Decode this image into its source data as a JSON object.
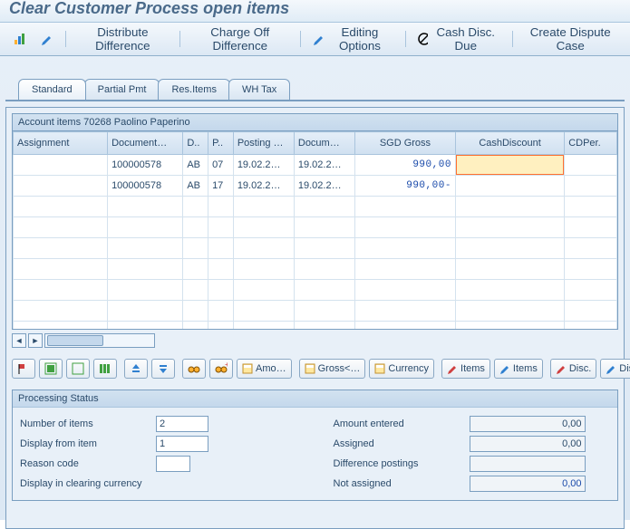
{
  "title": "Clear Customer Process open items",
  "toolbar": {
    "distribute": "Distribute Difference",
    "charge_off": "Charge Off Difference",
    "editing": "Editing Options",
    "cash_disc": "Cash Disc. Due",
    "dispute": "Create Dispute Case"
  },
  "tabs": [
    "Standard",
    "Partial Pmt",
    "Res.Items",
    "WH Tax"
  ],
  "active_tab": 0,
  "panel_title": "Account items 70268 Paolino Paperino",
  "columns": [
    {
      "key": "assignment",
      "label": "Assignment",
      "w": 90
    },
    {
      "key": "document",
      "label": "Document…",
      "w": 72
    },
    {
      "key": "d",
      "label": "D..",
      "w": 24
    },
    {
      "key": "p",
      "label": "P..",
      "w": 24
    },
    {
      "key": "posting",
      "label": "Posting …",
      "w": 58
    },
    {
      "key": "docum",
      "label": "Docum…",
      "w": 58
    },
    {
      "key": "sgd",
      "label": "SGD Gross",
      "w": 96
    },
    {
      "key": "cashdisc",
      "label": "CashDiscount",
      "w": 104
    },
    {
      "key": "cdper",
      "label": "CDPer.",
      "w": 50
    }
  ],
  "rows": [
    {
      "assignment": "",
      "document": "100000578",
      "d": "AB",
      "p": "07",
      "posting": "19.02.2…",
      "docum": "19.02.2…",
      "sgd": "990,00",
      "cashdisc": "",
      "cdper": "",
      "sel": "cashdisc"
    },
    {
      "assignment": "",
      "document": "100000578",
      "d": "AB",
      "p": "17",
      "posting": "19.02.2…",
      "docum": "19.02.2…",
      "sgd": "990,00-",
      "cashdisc": "",
      "cdper": ""
    }
  ],
  "buttons": {
    "amo": "Amo…",
    "gross": "Gross<…",
    "currency": "Currency",
    "items1": "Items",
    "items2": "Items",
    "disc1": "Disc.",
    "disc2": "Disc."
  },
  "status": {
    "title": "Processing Status",
    "left": {
      "num_items": {
        "label": "Number of items",
        "value": "2"
      },
      "display_from": {
        "label": "Display from item",
        "value": "1"
      },
      "reason": {
        "label": "Reason code",
        "value": ""
      },
      "clearing": {
        "label": "Display in clearing currency"
      }
    },
    "right": {
      "amount_entered": {
        "label": "Amount entered",
        "value": "0,00"
      },
      "assigned": {
        "label": "Assigned",
        "value": "0,00"
      },
      "diff": {
        "label": "Difference postings",
        "value": ""
      },
      "not_assigned": {
        "label": "Not assigned",
        "value": "0,00"
      }
    }
  }
}
